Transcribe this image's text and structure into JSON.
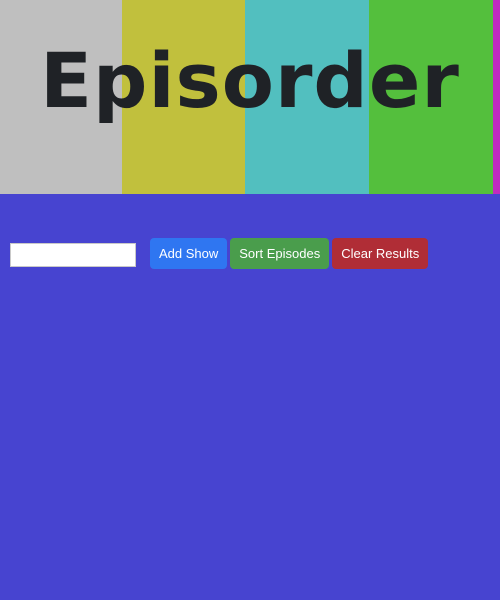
{
  "header": {
    "logo_text": "Episorder",
    "bar_colors": [
      "#bfbfbf",
      "#c1c03d",
      "#52bfbf",
      "#54bf3d",
      "#c02bbf"
    ]
  },
  "controls": {
    "input_value": "",
    "input_placeholder": "",
    "buttons": [
      {
        "label": "Add Show",
        "color": "#2f76f1"
      },
      {
        "label": "Sort Episodes",
        "color": "#4a9d4c"
      },
      {
        "label": "Clear Results",
        "color": "#b02d36"
      }
    ]
  },
  "colors": {
    "page_background": "#4744d0",
    "logo_text": "#1f2226"
  }
}
